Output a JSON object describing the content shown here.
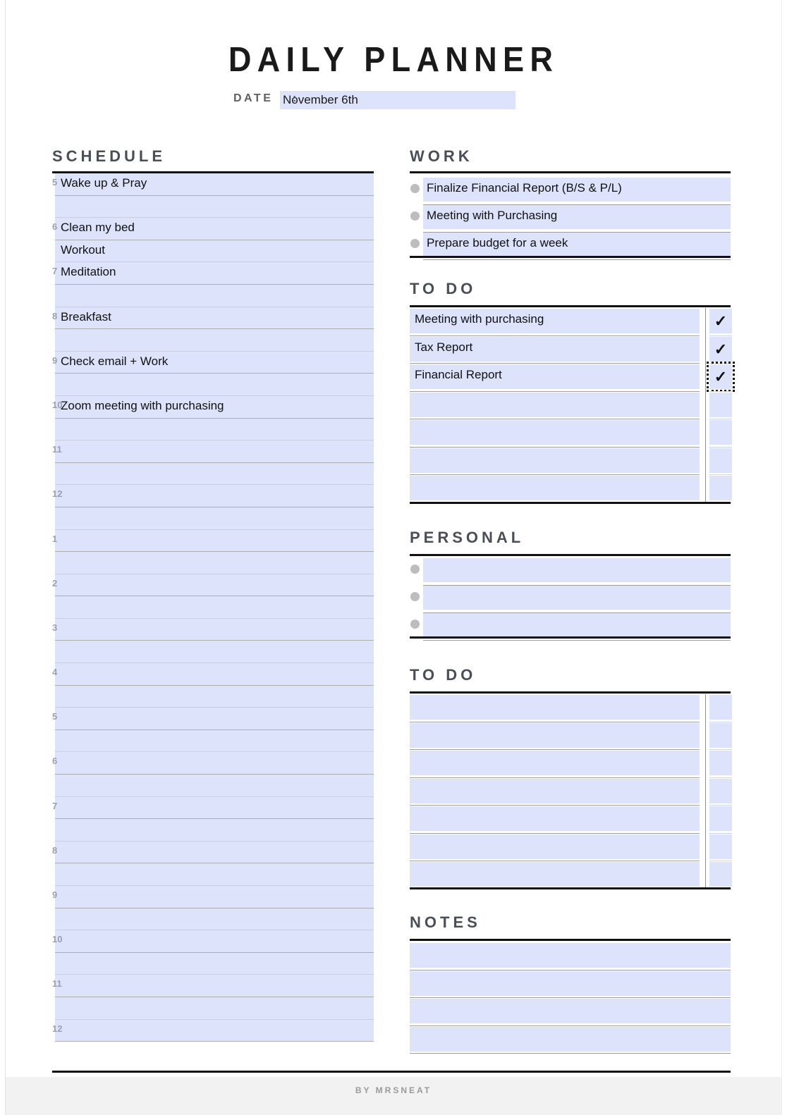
{
  "header": {
    "title": "DAILY PLANNER",
    "date_label": "DATE",
    "date_colon": ":",
    "date_value": "November 6th"
  },
  "colors": {
    "field_fill": "#dde3fb",
    "rule": "#111111",
    "heading": "#4a4f57",
    "hour_number": "#9aa0b4",
    "bullet": "#bdbdbd"
  },
  "schedule": {
    "heading": "SCHEDULE",
    "rows": [
      {
        "hour": "5",
        "text": "Wake up & Pray"
      },
      {
        "hour": "",
        "text": ""
      },
      {
        "hour": "6",
        "text": "Clean my bed"
      },
      {
        "hour": "",
        "text": "Workout"
      },
      {
        "hour": "7",
        "text": "Meditation"
      },
      {
        "hour": "",
        "text": ""
      },
      {
        "hour": "8",
        "text": "Breakfast"
      },
      {
        "hour": "",
        "text": ""
      },
      {
        "hour": "9",
        "text": "Check email + Work"
      },
      {
        "hour": "",
        "text": ""
      },
      {
        "hour": "10",
        "text": "Zoom meeting with purchasing"
      },
      {
        "hour": "",
        "text": ""
      },
      {
        "hour": "11",
        "text": ""
      },
      {
        "hour": "",
        "text": ""
      },
      {
        "hour": "12",
        "text": ""
      },
      {
        "hour": "",
        "text": ""
      },
      {
        "hour": "1",
        "text": ""
      },
      {
        "hour": "",
        "text": ""
      },
      {
        "hour": "2",
        "text": ""
      },
      {
        "hour": "",
        "text": ""
      },
      {
        "hour": "3",
        "text": ""
      },
      {
        "hour": "",
        "text": ""
      },
      {
        "hour": "4",
        "text": ""
      },
      {
        "hour": "",
        "text": ""
      },
      {
        "hour": "5",
        "text": ""
      },
      {
        "hour": "",
        "text": ""
      },
      {
        "hour": "6",
        "text": ""
      },
      {
        "hour": "",
        "text": ""
      },
      {
        "hour": "7",
        "text": ""
      },
      {
        "hour": "",
        "text": ""
      },
      {
        "hour": "8",
        "text": ""
      },
      {
        "hour": "",
        "text": ""
      },
      {
        "hour": "9",
        "text": ""
      },
      {
        "hour": "",
        "text": ""
      },
      {
        "hour": "10",
        "text": ""
      },
      {
        "hour": "",
        "text": ""
      },
      {
        "hour": "11",
        "text": ""
      },
      {
        "hour": "",
        "text": ""
      },
      {
        "hour": "12",
        "text": ""
      }
    ]
  },
  "work": {
    "heading": "WORK",
    "items": [
      {
        "text": "Finalize Financial Report (B/S & P/L)"
      },
      {
        "text": "Meeting with Purchasing"
      },
      {
        "text": "Prepare budget for a week"
      }
    ]
  },
  "todo_top": {
    "heading": "TO DO",
    "items": [
      {
        "text": "Meeting with purchasing",
        "checked": true,
        "focused": false
      },
      {
        "text": "Tax Report",
        "checked": true,
        "focused": false
      },
      {
        "text": "Financial Report",
        "checked": true,
        "focused": true
      },
      {
        "text": "",
        "checked": false,
        "focused": false
      },
      {
        "text": "",
        "checked": false,
        "focused": false
      },
      {
        "text": "",
        "checked": false,
        "focused": false
      },
      {
        "text": "",
        "checked": false,
        "focused": false
      }
    ],
    "check_glyph": "✓"
  },
  "personal": {
    "heading": "PERSONAL",
    "items": [
      {
        "text": ""
      },
      {
        "text": ""
      },
      {
        "text": ""
      }
    ]
  },
  "todo_bottom": {
    "heading": "TO DO",
    "items": [
      {
        "text": "",
        "checked": false,
        "focused": false
      },
      {
        "text": "",
        "checked": false,
        "focused": false
      },
      {
        "text": "",
        "checked": false,
        "focused": false
      },
      {
        "text": "",
        "checked": false,
        "focused": false
      },
      {
        "text": "",
        "checked": false,
        "focused": false
      },
      {
        "text": "",
        "checked": false,
        "focused": false
      },
      {
        "text": "",
        "checked": false,
        "focused": false
      }
    ],
    "check_glyph": "✓"
  },
  "notes": {
    "heading": "NOTES",
    "rows": [
      {
        "text": ""
      },
      {
        "text": ""
      },
      {
        "text": ""
      },
      {
        "text": ""
      }
    ]
  },
  "footer": {
    "credit": "BY MRSNEAT"
  }
}
